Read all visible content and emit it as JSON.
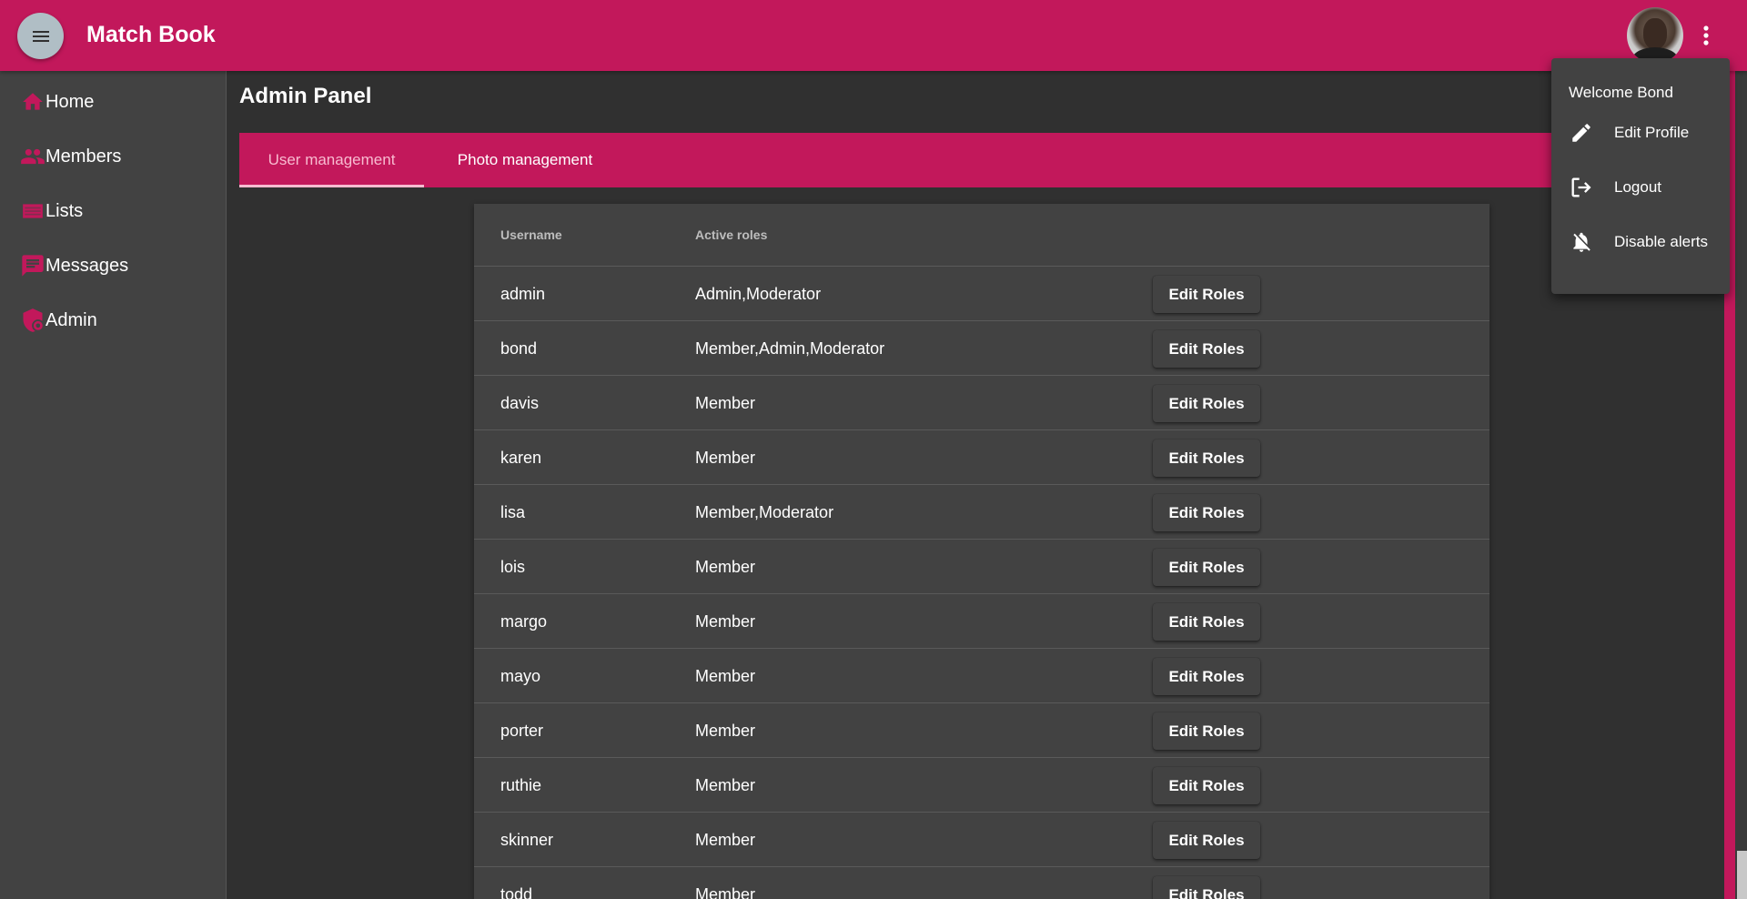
{
  "app": {
    "title": "Match Book"
  },
  "sidebar": {
    "items": [
      {
        "label": "Home",
        "icon": "home-icon"
      },
      {
        "label": "Members",
        "icon": "people-icon"
      },
      {
        "label": "Lists",
        "icon": "list-icon"
      },
      {
        "label": "Messages",
        "icon": "message-icon"
      },
      {
        "label": "Admin",
        "icon": "admin-shield-icon"
      }
    ]
  },
  "main": {
    "title": "Admin Panel",
    "tabs": [
      {
        "label": "User management",
        "active": true
      },
      {
        "label": "Photo management",
        "active": false
      }
    ],
    "table": {
      "headers": {
        "username": "Username",
        "roles": "Active roles"
      },
      "edit_label": "Edit Roles",
      "rows": [
        {
          "username": "admin",
          "roles": "Admin,Moderator"
        },
        {
          "username": "bond",
          "roles": "Member,Admin,Moderator"
        },
        {
          "username": "davis",
          "roles": "Member"
        },
        {
          "username": "karen",
          "roles": "Member"
        },
        {
          "username": "lisa",
          "roles": "Member,Moderator"
        },
        {
          "username": "lois",
          "roles": "Member"
        },
        {
          "username": "margo",
          "roles": "Member"
        },
        {
          "username": "mayo",
          "roles": "Member"
        },
        {
          "username": "porter",
          "roles": "Member"
        },
        {
          "username": "ruthie",
          "roles": "Member"
        },
        {
          "username": "skinner",
          "roles": "Member"
        },
        {
          "username": "todd",
          "roles": "Member"
        }
      ]
    }
  },
  "user_menu": {
    "welcome": "Welcome Bond",
    "items": [
      {
        "label": "Edit Profile",
        "icon": "pencil-icon"
      },
      {
        "label": "Logout",
        "icon": "logout-icon"
      },
      {
        "label": "Disable alerts",
        "icon": "bell-off-icon"
      }
    ]
  },
  "colors": {
    "primary": "#c2185b",
    "accent": "#f8bbd0",
    "background": "#303030",
    "surface": "#424242"
  }
}
